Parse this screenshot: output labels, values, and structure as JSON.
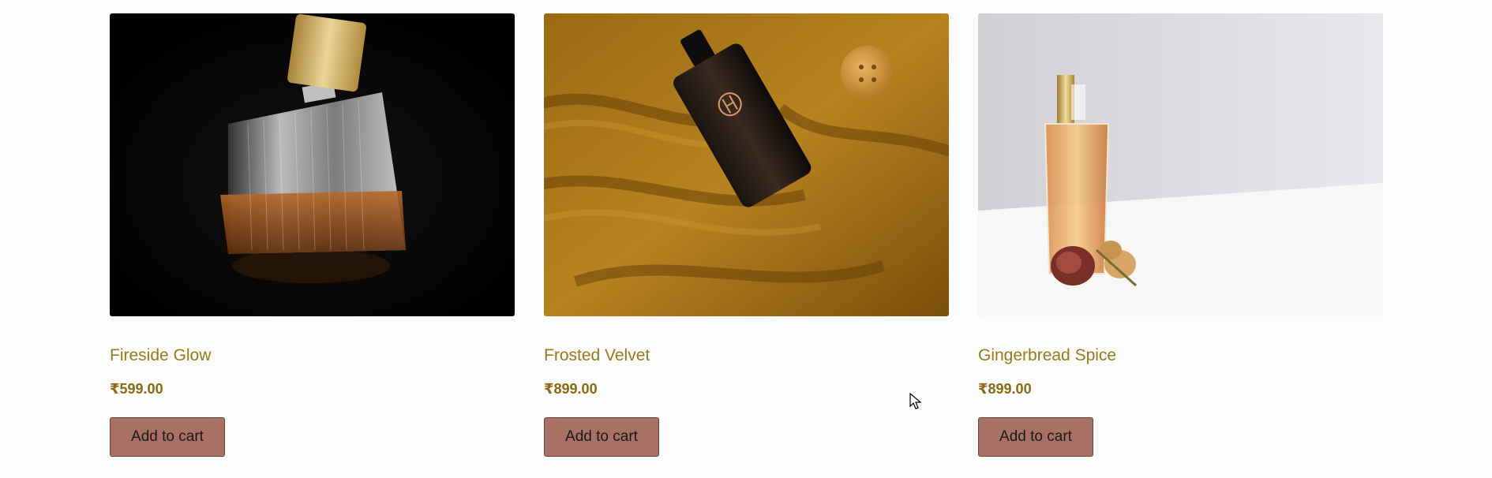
{
  "products": [
    {
      "name": "Fireside Glow",
      "price": "₹599.00",
      "button_label": "Add to cart",
      "image_desc": "faceted glass perfume bottle with gold cap on black"
    },
    {
      "name": "Frosted Velvet",
      "price": "₹899.00",
      "button_label": "Add to cart",
      "image_desc": "dark perfume bottle on mustard knit sweater"
    },
    {
      "name": "Gingerbread Spice",
      "price": "₹899.00",
      "button_label": "Add to cart",
      "image_desc": "amber perfume bottle with dried rose on white"
    }
  ],
  "colors": {
    "title": "#9a7a16",
    "price": "#8a6a10",
    "button_bg": "#a97066",
    "page_bg": "#fcfcfc"
  }
}
